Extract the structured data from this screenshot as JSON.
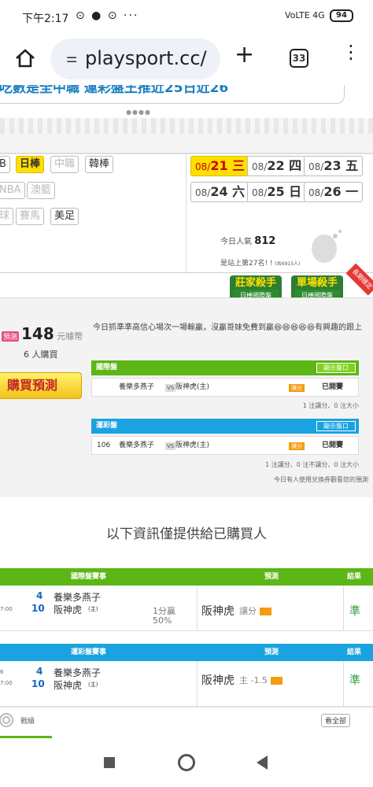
{
  "status_bar": {
    "time": "下午2:17",
    "icons_text": "⊙ ● ⊙ ···",
    "network": "VoLTE 4G",
    "battery": "94"
  },
  "browser": {
    "url": "playsport.cc/",
    "tab_count": "33"
  },
  "banner": {
    "text": "吃數是全中職 運彩盤王推近25日近26"
  },
  "leagues_row1": [
    "B",
    "日棒",
    "中職",
    "韓棒"
  ],
  "leagues_row2": [
    "NBA",
    "澳籃"
  ],
  "leagues_row3": [
    "球",
    "賽馬",
    "美足"
  ],
  "dates": [
    {
      "prefix": "08/",
      "day": "21",
      "wd": "三",
      "active": true
    },
    {
      "prefix": "08/",
      "day": "22",
      "wd": "四"
    },
    {
      "prefix": "08/",
      "day": "23",
      "wd": "五"
    },
    {
      "prefix": "08/",
      "day": "24",
      "wd": "六"
    },
    {
      "prefix": "08/",
      "day": "25",
      "wd": "日"
    },
    {
      "prefix": "08/",
      "day": "26",
      "wd": "一"
    }
  ],
  "popularity": {
    "label": "今日人氣",
    "value": "812"
  },
  "rank_text": "是站上第27名! !",
  "rank_small": "(共6915人)",
  "badges": [
    {
      "title": "莊家殺手",
      "sub": "日棒國際盤"
    },
    {
      "title": "單場殺手",
      "sub": "日棒國際盤"
    }
  ],
  "ribbon": "長期穩定",
  "price": {
    "label": "預測",
    "value": "148",
    "unit": "元噱幣"
  },
  "buyers": "6 人購買",
  "buy_button": "購買預測",
  "description": "今日抓準準高信心場次一場輸贏，沒贏哥妹免費到贏😆😆😆😆😆有興趣的跟上",
  "intl_section": {
    "title": "國際盤",
    "show": "顯示盤口",
    "home": "養樂多燕子",
    "vs": "VS",
    "away": "阪神虎(主)",
    "odds_tag": "讓分",
    "status": "已開賽",
    "note": "1 注讓分、0 注大小"
  },
  "lottery_section": {
    "title": "運彩盤",
    "show": "顯示盤口",
    "num": "106",
    "home": "養樂多燕子",
    "vs": "VS",
    "away": "阪神虎(主)",
    "odds_tag": "讓分",
    "status": "已開賽",
    "note": "1 注讓分、0 注不讓分、0 注大小",
    "note2": "今日有人使用兌換券觀看您的預測"
  },
  "info_title": "以下資訊僅提供給已購買人",
  "table_intl": {
    "header": "國際盤賽事",
    "pred": "預測",
    "result": "結果",
    "time": "7:00",
    "num1": "4",
    "team1": "養樂多燕子",
    "num2": "10",
    "team2": "阪神虎",
    "home_tag": "(主)",
    "line1": "1分贏",
    "line2": "50%",
    "prediction": "阪神虎",
    "pred_type": "讓分",
    "outcome": "準"
  },
  "table_lottery": {
    "header": "運彩盤賽事",
    "pred": "預測",
    "result": "結果",
    "time_top": "6",
    "time": "7:00",
    "num1": "4",
    "team1": "養樂多燕子",
    "num2": "10",
    "team2": "阪神虎",
    "home_tag": "(主)",
    "prediction": "阪神虎",
    "pred_type": "主 -1.5",
    "outcome": "準"
  },
  "footer": {
    "label": "戰績",
    "view_all": "看全部"
  },
  "colors": {
    "green": "#5cb615",
    "blue": "#1aa3e0",
    "yellow": "#ffe000",
    "hit": "#2e9e3a"
  }
}
